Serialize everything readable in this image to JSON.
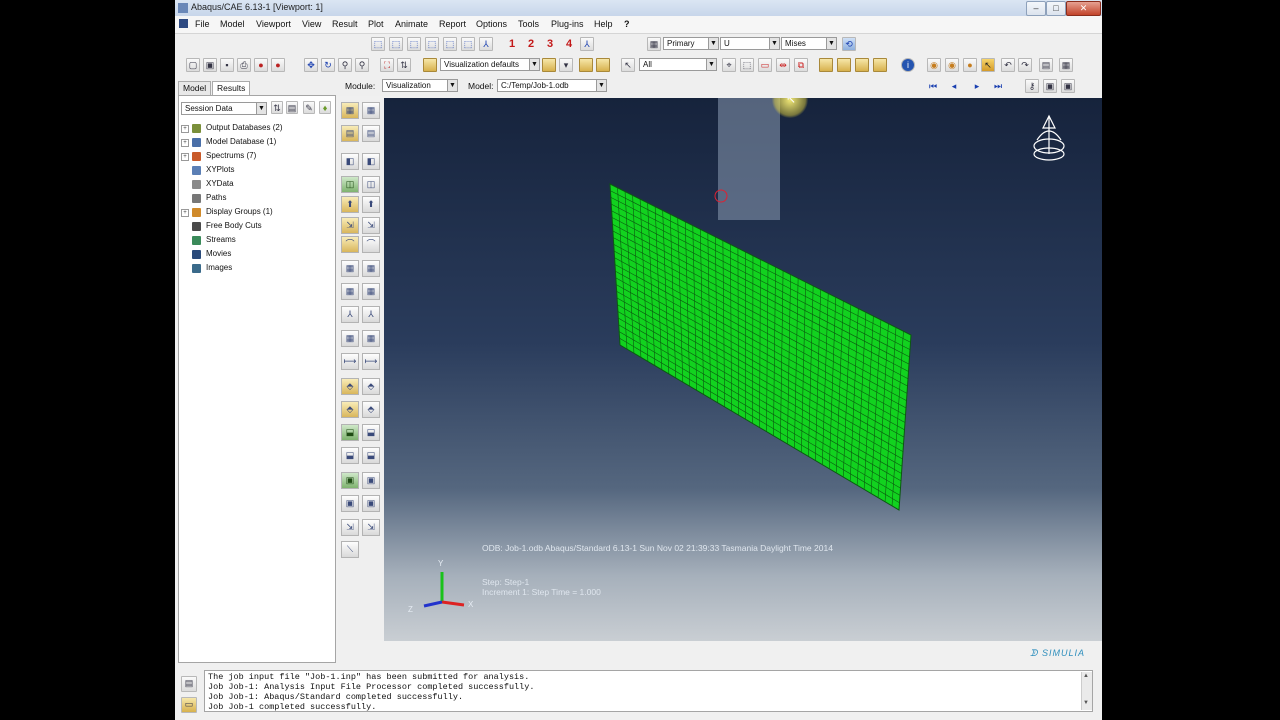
{
  "window": {
    "title": "Abaqus/CAE 6.13-1 [Viewport: 1]",
    "controls": {
      "minimize": "–",
      "maximize": "□",
      "close": "✕"
    }
  },
  "menu": [
    "File",
    "Model",
    "Viewport",
    "View",
    "Result",
    "Plot",
    "Animate",
    "Report",
    "Options",
    "Tools",
    "Plug-ins",
    "Help",
    "?"
  ],
  "toolbar": {
    "view_numbers": [
      "1",
      "2",
      "3",
      "4"
    ],
    "visualization_defaults": "Visualization defaults",
    "selection": "All",
    "field_output": {
      "invariant": "Primary",
      "variable": "U",
      "component": "Mises"
    }
  },
  "context": {
    "module_label": "Module:",
    "module": "Visualization",
    "model_label": "Model:",
    "model": "C:/Temp/Job-1.odb"
  },
  "left_panel": {
    "tabs": [
      "Model",
      "Results"
    ],
    "session_combo": "Session Data",
    "tree": [
      {
        "label": "Output Databases (2)",
        "expandable": true,
        "icon": "database-icon",
        "color": "#7a8f3a"
      },
      {
        "label": "Model Database (1)",
        "expandable": true,
        "icon": "model-db-icon",
        "color": "#4a6fa8"
      },
      {
        "label": "Spectrums (7)",
        "expandable": true,
        "icon": "spectrum-icon",
        "color": "#c95a2a"
      },
      {
        "label": "XYPlots",
        "expandable": false,
        "icon": "xyplot-icon",
        "color": "#5b7fb5"
      },
      {
        "label": "XYData",
        "expandable": false,
        "icon": "xydata-icon",
        "color": "#8a8a8a"
      },
      {
        "label": "Paths",
        "expandable": false,
        "icon": "paths-icon",
        "color": "#777777"
      },
      {
        "label": "Display Groups (1)",
        "expandable": true,
        "icon": "display-group-icon",
        "color": "#d08a2a"
      },
      {
        "label": "Free Body Cuts",
        "expandable": false,
        "icon": "free-body-icon",
        "color": "#4a4a4a"
      },
      {
        "label": "Streams",
        "expandable": false,
        "icon": "streams-icon",
        "color": "#3a8a5a"
      },
      {
        "label": "Movies",
        "expandable": false,
        "icon": "movies-icon",
        "color": "#2a4a7a"
      },
      {
        "label": "Images",
        "expandable": false,
        "icon": "images-icon",
        "color": "#3a6a8a"
      }
    ]
  },
  "viewport": {
    "mesh_color": "#12d21f",
    "mesh_line_color": "#0b5a10",
    "odb_line": "ODB: Job-1.odb    Abaqus/Standard 6.13-1    Sun Nov 02 21:39:33 Tasmania Daylight Time 2014",
    "step_line": "Step: Step-1",
    "increment_line": "Increment     1: Step Time =     1.000",
    "triad": {
      "y": "Y",
      "x": "X",
      "z": "Z"
    },
    "brand": "SIMULIA"
  },
  "messages": [
    "The job input file \"Job-1.inp\" has been submitted for analysis.",
    "Job Job-1: Analysis Input File Processor completed successfully.",
    "Job Job-1: Abaqus/Standard completed successfully.",
    "Job Job-1 completed successfully."
  ]
}
